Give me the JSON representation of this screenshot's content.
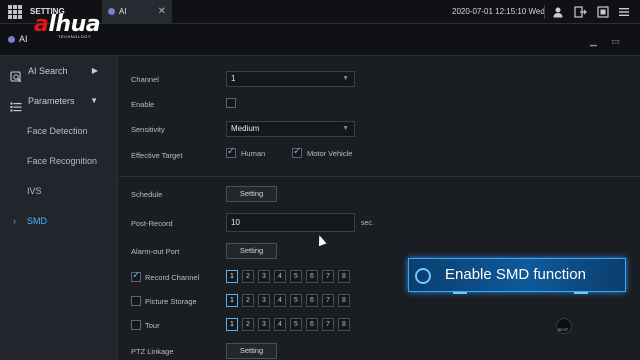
{
  "topbar": {
    "setting_tab": "SETTING",
    "ai_tab": "AI",
    "datetime": "2020-07-01 12:15:10 Wed",
    "close_glyph": "✕"
  },
  "subbar": {
    "title": "AI",
    "logo_prefix": "a",
    "logo_main": "lhua",
    "logo_sub": "TECHNOLOGY"
  },
  "sidebar": {
    "ai_search": "AI Search",
    "parameters": "Parameters",
    "items": [
      "Face Detection",
      "Face Recognition",
      "IVS",
      "SMD"
    ],
    "active": "SMD"
  },
  "form": {
    "channel_label": "Channel",
    "channel_value": "1",
    "enable_label": "Enable",
    "sensitivity_label": "Sensitivity",
    "sensitivity_value": "Medium",
    "effective_target_label": "Effective Target",
    "human_label": "Human",
    "motor_label": "Motor Vehicle",
    "schedule_label": "Schedule",
    "setting_btn": "Setting",
    "post_record_label": "Post-Record",
    "post_record_value": "10",
    "post_record_unit": "sec.",
    "alarm_out_label": "Alarm-out Port",
    "record_channel_label": "Record Channel",
    "picture_storage_label": "Picture Storage",
    "tour_label": "Tour",
    "ptz_label": "PTZ Linkage",
    "channels": [
      "1",
      "2",
      "3",
      "4",
      "5",
      "6",
      "7",
      "8"
    ]
  },
  "overlay": {
    "banner_text": "Enable SMD function",
    "watermark_text": "00:37"
  },
  "colors": {
    "accent": "#4fb2ff",
    "brand_red": "#e0161d"
  }
}
